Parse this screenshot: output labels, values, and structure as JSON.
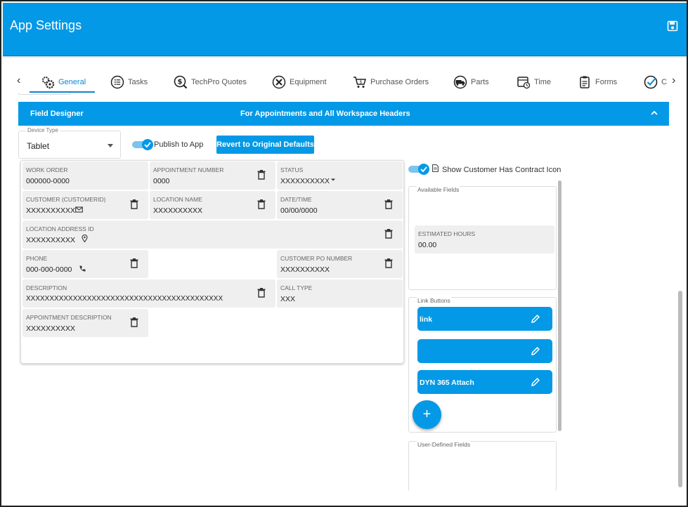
{
  "app": {
    "title": "App Settings"
  },
  "tabs": [
    {
      "label": "General",
      "icon": "gears-icon",
      "active": true
    },
    {
      "label": "Tasks",
      "icon": "list-icon"
    },
    {
      "label": "TechPro Quotes",
      "icon": "dollar-search-icon"
    },
    {
      "label": "Equipment",
      "icon": "tools-icon"
    },
    {
      "label": "Purchase Orders",
      "icon": "cart-icon"
    },
    {
      "label": "Parts",
      "icon": "truck-icon"
    },
    {
      "label": "Time",
      "icon": "calendar-clock-icon"
    },
    {
      "label": "Forms",
      "icon": "clipboard-icon"
    },
    {
      "label": "C",
      "icon": "check-circle-icon"
    }
  ],
  "field_designer": {
    "title": "Field Designer",
    "subtitle": "For Appointments and All Workspace Headers"
  },
  "device_type": {
    "label": "Device Type",
    "value": "Tablet"
  },
  "publish_label": "Publish to App",
  "revert_label": "Revert to Original Defaults",
  "fields": {
    "work_order": {
      "label": "WORK ORDER",
      "value": "000000-0000"
    },
    "appointment_number": {
      "label": "APPOINTMENT NUMBER",
      "value": "0000"
    },
    "status": {
      "label": "STATUS",
      "value": "XXXXXXXXXX"
    },
    "customer": {
      "label": "CUSTOMER (CUSTOMERID)",
      "value": "XXXXXXXXXX"
    },
    "location_name": {
      "label": "LOCATION NAME",
      "value": "XXXXXXXXXX"
    },
    "datetime": {
      "label": "DATE/TIME",
      "value": "00/00/0000"
    },
    "location_address": {
      "label": "LOCATION ADDRESS ID",
      "value": "XXXXXXXXXX"
    },
    "phone": {
      "label": "PHONE",
      "value": "000-000-0000"
    },
    "customer_po": {
      "label": "CUSTOMER PO NUMBER",
      "value": "XXXXXXXXXX"
    },
    "description": {
      "label": "DESCRIPTION",
      "value": "XXXXXXXXXXXXXXXXXXXXXXXXXXXXXXXXXXXXXXXXXX"
    },
    "call_type": {
      "label": "CALL TYPE",
      "value": "XXX"
    },
    "appointment_description": {
      "label": "APPOINTMENT DESCRIPTION",
      "value": "XXXXXXXXXX"
    }
  },
  "sidebar": {
    "contract_label": "Show Customer Has Contract Icon",
    "available_fields_label": "Available Fields",
    "available_fields": [
      {
        "label": "ESTIMATED HOURS",
        "value": "00.00"
      }
    ],
    "link_buttons_label": "Link Buttons",
    "link_buttons": [
      {
        "label": "link"
      },
      {
        "label": ""
      },
      {
        "label": "DYN 365 Attach"
      }
    ],
    "add_label": "+",
    "user_defined_label": "User-Defined Fields"
  },
  "colors": {
    "primary": "#0399e6",
    "field_bg": "#efefef"
  }
}
